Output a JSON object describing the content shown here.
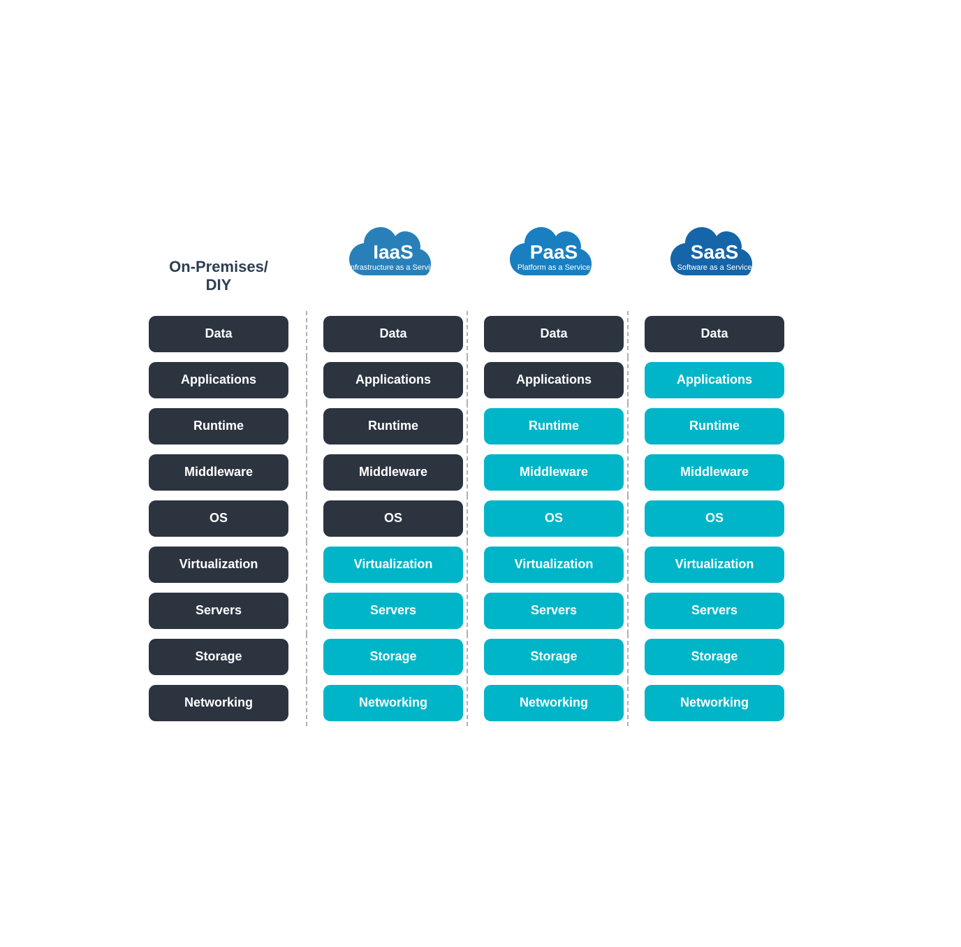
{
  "columns": [
    {
      "id": "on-premises",
      "headerType": "text",
      "title": "On-Premises/\nDIY",
      "cloudColor": null,
      "cloudMainLabel": null,
      "cloudSubLabel": null
    },
    {
      "id": "iaas",
      "headerType": "cloud",
      "title": null,
      "cloudColor": "#2980b9",
      "cloudMainLabel": "IaaS",
      "cloudSubLabel": "Infrastructure as a Service"
    },
    {
      "id": "paas",
      "headerType": "cloud",
      "title": null,
      "cloudColor": "#1a7fc1",
      "cloudMainLabel": "PaaS",
      "cloudSubLabel": "Platform as a Service"
    },
    {
      "id": "saas",
      "headerType": "cloud",
      "title": null,
      "cloudColor": "#1565a8",
      "cloudMainLabel": "SaaS",
      "cloudSubLabel": "Software as a Service"
    }
  ],
  "rows": [
    {
      "label": "Data",
      "styles": [
        "dark",
        "dark",
        "dark",
        "dark"
      ]
    },
    {
      "label": "Applications",
      "styles": [
        "dark",
        "dark",
        "dark",
        "teal"
      ]
    },
    {
      "label": "Runtime",
      "styles": [
        "dark",
        "dark",
        "teal",
        "teal"
      ]
    },
    {
      "label": "Middleware",
      "styles": [
        "dark",
        "dark",
        "teal",
        "teal"
      ]
    },
    {
      "label": "OS",
      "styles": [
        "dark",
        "dark",
        "teal",
        "teal"
      ]
    },
    {
      "label": "Virtualization",
      "styles": [
        "dark",
        "teal",
        "teal",
        "teal"
      ]
    },
    {
      "label": "Servers",
      "styles": [
        "dark",
        "teal",
        "teal",
        "teal"
      ]
    },
    {
      "label": "Storage",
      "styles": [
        "dark",
        "teal",
        "teal",
        "teal"
      ]
    },
    {
      "label": "Networking",
      "styles": [
        "dark",
        "teal",
        "teal",
        "teal"
      ]
    }
  ],
  "colors": {
    "dark": "#2c3440",
    "teal": "#00b5c8",
    "cloud_iaas": "#2980b9",
    "cloud_paas": "#1a7fc1",
    "cloud_saas": "#1565a8"
  }
}
